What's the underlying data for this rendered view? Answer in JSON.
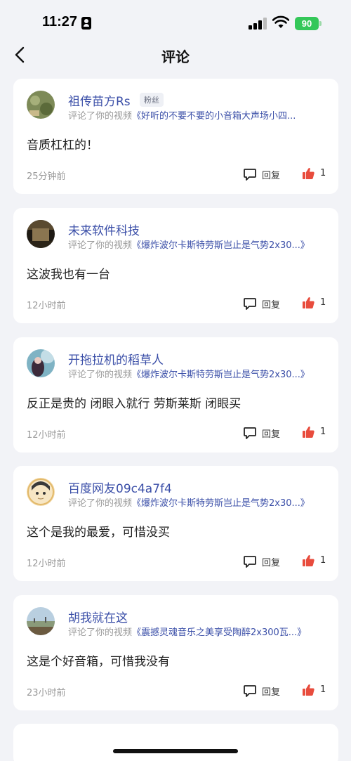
{
  "status_bar": {
    "time": "11:27",
    "battery": "90"
  },
  "nav": {
    "title": "评论"
  },
  "comments": [
    {
      "username": "祖传苗方Rs",
      "badge": "粉丝",
      "ref_prefix": "评论了你的视频",
      "ref_title": "《好听的不要不要的小音箱大声场小四...",
      "text": "音质杠杠的！",
      "time": "25分钟前",
      "reply_label": "回复",
      "likes": "1"
    },
    {
      "username": "未来软件科技",
      "ref_prefix": "评论了你的视频",
      "ref_title": "《爆炸波尔卡斯特劳斯岂止是气势2x30...》",
      "text": "这波我也有一台",
      "time": "12小时前",
      "reply_label": "回复",
      "likes": "1"
    },
    {
      "username": "开拖拉机的稻草人",
      "ref_prefix": "评论了你的视频",
      "ref_title": "《爆炸波尔卡斯特劳斯岂止是气势2x30...》",
      "text": "反正是贵的 闭眼入就行 劳斯莱斯 闭眼买",
      "time": "12小时前",
      "reply_label": "回复",
      "likes": "1"
    },
    {
      "username": "百度网友09c4a7f4",
      "ref_prefix": "评论了你的视频",
      "ref_title": "《爆炸波尔卡斯特劳斯岂止是气势2x30...》",
      "text": "这个是我的最爱，可惜没买",
      "time": "12小时前",
      "reply_label": "回复",
      "likes": "1"
    },
    {
      "username": "胡我就在这",
      "ref_prefix": "评论了你的视频",
      "ref_title": "《震撼灵魂音乐之美享受陶醉2x300瓦...》",
      "text": "这是个好音箱，可惜我没有",
      "time": "23小时前",
      "reply_label": "回复",
      "likes": "1"
    }
  ],
  "colors": {
    "accent": "#3b4fa8",
    "like": "#e84c3d",
    "background": "#f2f3f7",
    "battery": "#34c759"
  }
}
